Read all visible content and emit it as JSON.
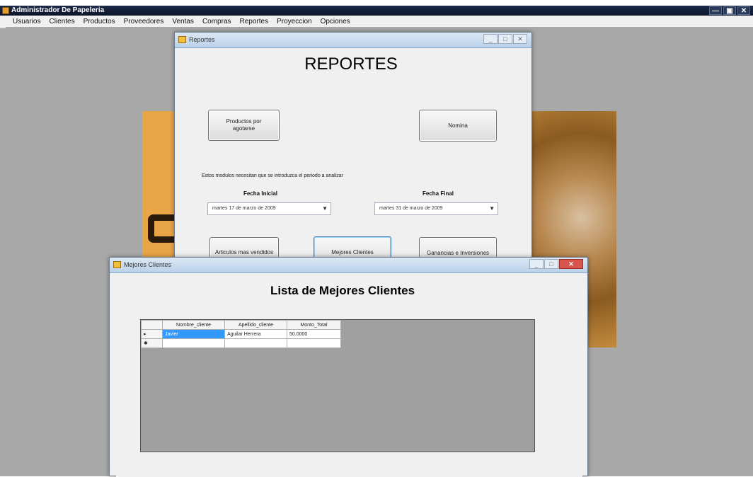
{
  "app": {
    "title": "Administrador De Papeleria",
    "controls": [
      "—",
      "▣",
      "✕"
    ],
    "menu": [
      "Usuarios",
      "Clientes",
      "Productos",
      "Proveedores",
      "Ventas",
      "Compras",
      "Reportes",
      "Proyeccion",
      "Opciones"
    ]
  },
  "reportes": {
    "window_title": "Reportes",
    "heading": "REPORTES",
    "btn_productos": "Productos por agotarse",
    "btn_nomina": "Nomina",
    "note": "Estos modulos necesitan que se introduzca el periodo a analizar",
    "fecha_inicial_label": "Fecha Inicial",
    "fecha_final_label": "Fecha Final",
    "fecha_inicial_value": "martes   17 de   marzo   de 2009",
    "fecha_final_value": "martes   31 de   marzo   de 2009",
    "btn_articulos": "Articulos mas vendidos",
    "btn_mejores": "Mejores Clientes",
    "btn_ganancias": "Ganancias e Inversiones"
  },
  "clientes": {
    "window_title": "Mejores Clientes",
    "heading": "Lista de Mejores Clientes",
    "columns": [
      "Nombre_cliente",
      "Apellido_cliente",
      "Monto_Total"
    ],
    "rows": [
      {
        "indicator": "▸",
        "nombre": "Javier",
        "apellido": "Aguilar Herrera",
        "monto": "50.0000"
      },
      {
        "indicator": "✱",
        "nombre": "",
        "apellido": "",
        "monto": ""
      }
    ]
  },
  "colors": {
    "background_gray": "#a8a8a8",
    "selection_blue": "#3399ff",
    "close_red": "#d9534f"
  }
}
